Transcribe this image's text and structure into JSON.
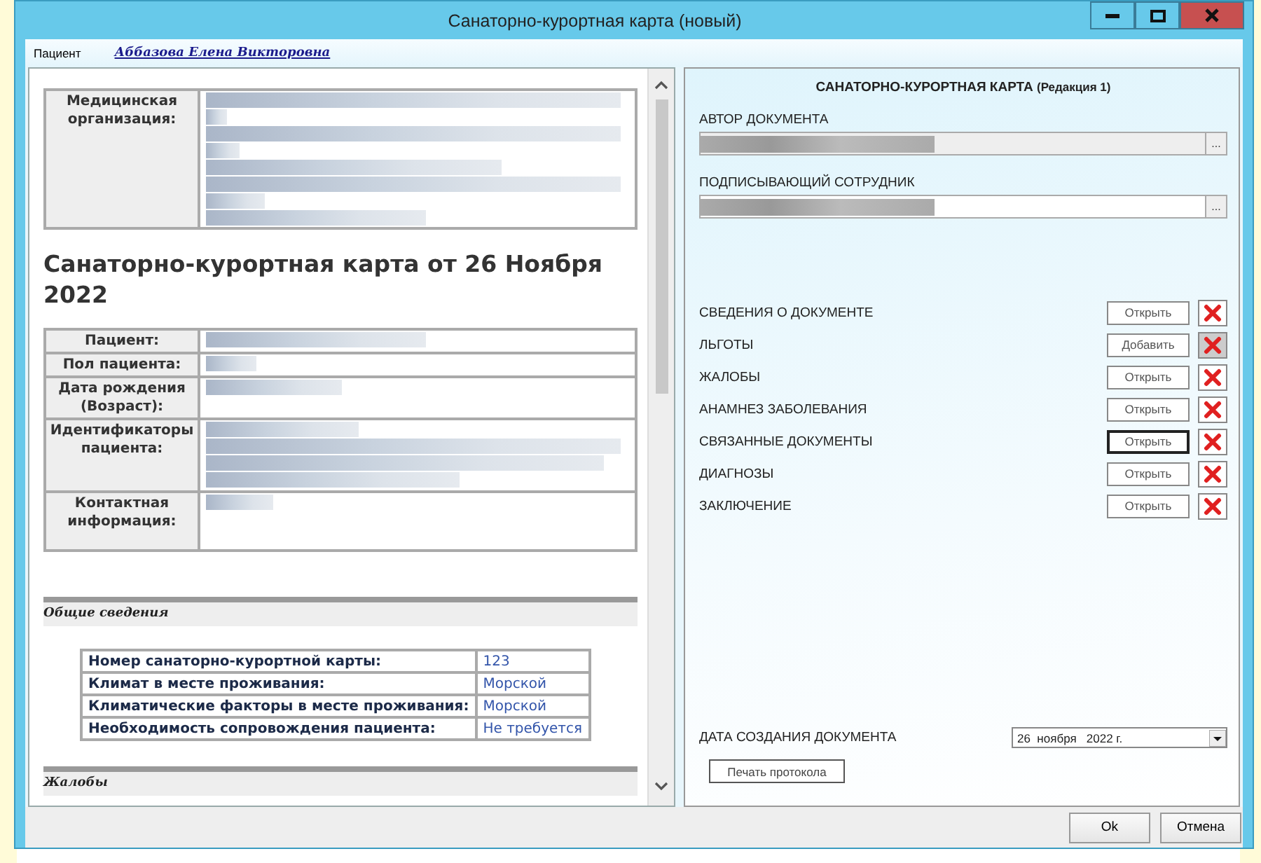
{
  "window": {
    "title": "Санаторно-курортная карта (новый)"
  },
  "patient_bar": {
    "label": "Пациент",
    "name": "Аббазова Елена Викторовна"
  },
  "document": {
    "org_label": "Медицинская организация:",
    "heading": "Санаторно-курортная карта от 26 Ноября 2022",
    "patient_fields": [
      {
        "label": "Пациент:"
      },
      {
        "label": "Пол пациента:"
      },
      {
        "label": "Дата рождения (Возраст):"
      },
      {
        "label": "Идентификаторы пациента:"
      },
      {
        "label": "Контактная информация:"
      }
    ],
    "general_section": "Общие сведения",
    "general_rows": [
      {
        "label": "Номер санаторно-курортной карты:",
        "value": "123"
      },
      {
        "label": "Климат в месте проживания:",
        "value": "Морской"
      },
      {
        "label": "Климатические факторы в месте проживания:",
        "value": "Морской"
      },
      {
        "label": "Необходимость сопровождения пациента:",
        "value": "Не требуется"
      }
    ],
    "complaints_section": "Жалобы"
  },
  "card": {
    "title": "САНАТОРНО-КУРОРТНАЯ КАРТА",
    "edition": "(Редакция 1)",
    "author_label": "АВТОР ДОКУМЕНТА",
    "signer_label": "ПОДПИСЫВАЮЩИЙ СОТРУДНИК",
    "browse_label": "...",
    "sections": [
      {
        "label": "СВЕДЕНИЯ О ДОКУМЕНТЕ",
        "button": "Открыть",
        "focused": false,
        "delete_disabled": false
      },
      {
        "label": "ЛЬГОТЫ",
        "button": "Добавить",
        "focused": false,
        "delete_disabled": true
      },
      {
        "label": "ЖАЛОБЫ",
        "button": "Открыть",
        "focused": false,
        "delete_disabled": false
      },
      {
        "label": "АНАМНЕЗ ЗАБОЛЕВАНИЯ",
        "button": "Открыть",
        "focused": false,
        "delete_disabled": false
      },
      {
        "label": "СВЯЗАННЫЕ ДОКУМЕНТЫ",
        "button": "Открыть",
        "focused": true,
        "delete_disabled": false
      },
      {
        "label": "ДИАГНОЗЫ",
        "button": "Открыть",
        "focused": false,
        "delete_disabled": false
      },
      {
        "label": "ЗАКЛЮЧЕНИЕ",
        "button": "Открыть",
        "focused": false,
        "delete_disabled": false
      }
    ],
    "date_label": "ДАТА СОЗДАНИЯ ДОКУМЕНТА",
    "date_value": "26  ноября   2022 г.",
    "print_button": "Печать протокола"
  },
  "footer_buttons": [
    "Ok",
    "Отмена"
  ]
}
